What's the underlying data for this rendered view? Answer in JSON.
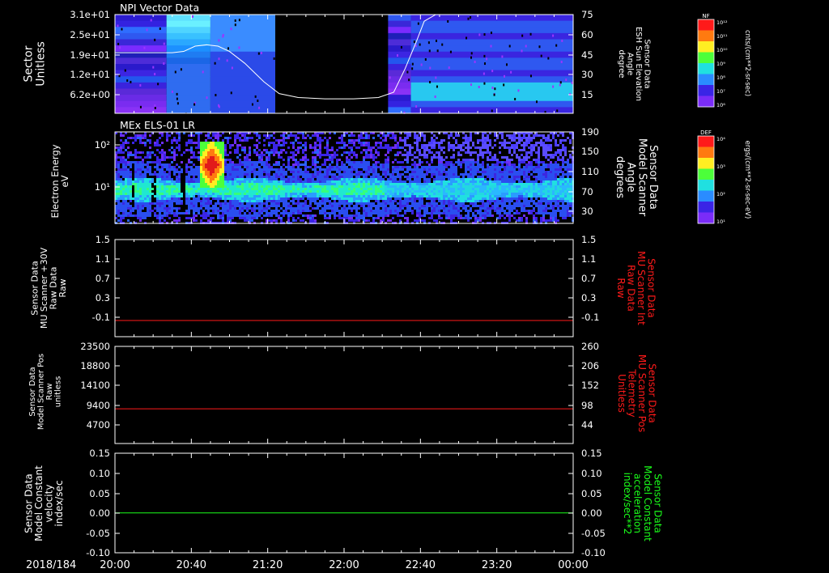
{
  "colors": {
    "background": "#000000",
    "axes": "#ffffff",
    "red_trace": "#ff1a1a",
    "green_trace": "#1aff1a",
    "white_trace": "#ffffff"
  },
  "chart_data": [
    {
      "type": "heatmap",
      "panel": 1,
      "title": "NPI Vector Data",
      "ylabel": "Sector\nUnitless",
      "yticks": [
        "3.1e+01",
        "2.5e+01",
        "1.9e+01",
        "1.2e+01",
        "6.2e+00"
      ],
      "y2label": "Sensor Data\nESH Sun Elevation\nAngle\ndegree",
      "y2ticks": [
        75,
        60,
        45,
        30,
        15
      ],
      "y2lim": [
        0,
        75
      ],
      "colorbar": {
        "label": "NF",
        "units": "cnts/(cm**2-sr-sec)",
        "ticks": [
          "10¹²",
          "10¹¹",
          "10¹⁰",
          "10⁹",
          "10⁸",
          "10⁷",
          "10⁶"
        ]
      },
      "gap_minutes": [
        84,
        143
      ],
      "overlay_line": {
        "name": "ESH Sun Elevation Angle",
        "x_minutes": [
          0,
          30,
          36,
          42,
          48,
          54,
          60,
          68,
          78,
          86,
          96,
          110,
          125,
          138,
          146,
          152,
          158,
          162,
          168
        ],
        "y": [
          46,
          46,
          47,
          51,
          52,
          51,
          47,
          38,
          24,
          15,
          12,
          11,
          11,
          12,
          16,
          34,
          55,
          70,
          75
        ]
      }
    },
    {
      "type": "heatmap",
      "panel": 2,
      "title": "MEx ELS-01 LR",
      "ylabel": "Electron Energy\neV",
      "yticks": [
        "10²",
        "10¹"
      ],
      "y2label": "Sensor Data\nModel Scanner\nAngle\ndegrees",
      "y2ticks": [
        190,
        150,
        110,
        70,
        30
      ],
      "y2lim": [
        10,
        190
      ],
      "colorbar": {
        "label": "DEF",
        "units": "ergs/(cm**2-sr-sec-eV)",
        "ticks": [
          "10⁴",
          "10³",
          "10²",
          "10¹"
        ]
      }
    },
    {
      "type": "line",
      "panel": 3,
      "ylabel": "Sensor Data\nMU Scanner +30V\nRaw Data\nRaw",
      "yticks": [
        "1.5",
        "1.1",
        "0.7",
        "0.3",
        "-0.1"
      ],
      "ylim": [
        -0.3,
        1.5
      ],
      "y2label": "Sensor Data\nMU Scanner Int\nRaw Data\nRaw",
      "y2ticks": [
        "1.5",
        "1.1",
        "0.7",
        "0.3",
        "-0.1"
      ],
      "series": [
        {
          "name": "MU Scanner Int Raw Data",
          "color": "#ff1a1a",
          "value": 0.0
        }
      ]
    },
    {
      "type": "line",
      "panel": 4,
      "ylabel": "Sensor Data\nModel Scanner Pos\nRaw\nunitless",
      "yticks": [
        "23500",
        "18800",
        "14100",
        "9400",
        "4700"
      ],
      "ylim": [
        0,
        23500
      ],
      "y2label": "Sensor Data\nMU Scanner Pos\nTelemetry\nUnitless",
      "y2ticks": [
        "260",
        "206",
        "152",
        "98",
        "44"
      ],
      "series": [
        {
          "name": "MU Scanner Pos Telemetry",
          "color": "#ff1a1a",
          "value": 8400
        }
      ]
    },
    {
      "type": "line",
      "panel": 5,
      "ylabel": "Sensor Data\nModel Constant\nvelocity\nindex/sec",
      "yticks": [
        "0.15",
        "0.10",
        "0.05",
        "0.00",
        "-0.05",
        "-0.10"
      ],
      "ylim": [
        -0.1,
        0.15
      ],
      "y2label": "Sensor Data\nModel Constant\nacceleration\nindex/sec**2",
      "y2ticks": [
        "0.15",
        "0.10",
        "0.05",
        "0.00",
        "-0.05",
        "-0.10"
      ],
      "series": [
        {
          "name": "Model Constant acceleration",
          "color": "#1aff1a",
          "value": 0.0
        }
      ]
    }
  ],
  "x_axis": {
    "date_label": "2018/184",
    "tick_labels": [
      "20:00",
      "20:40",
      "21:20",
      "22:00",
      "22:40",
      "23:20",
      "00:00"
    ],
    "range_minutes": [
      0,
      240
    ]
  }
}
